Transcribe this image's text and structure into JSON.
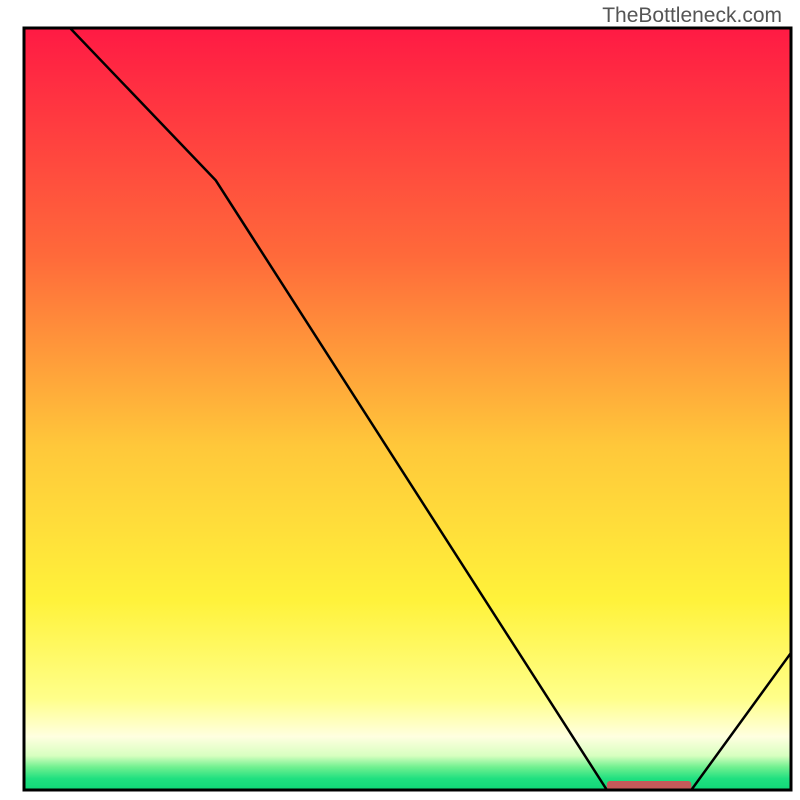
{
  "watermark": "TheBottleneck.com",
  "chart_data": {
    "type": "line",
    "title": "",
    "xlabel": "",
    "ylabel": "",
    "xlim": [
      0,
      100
    ],
    "ylim": [
      0,
      100
    ],
    "x": [
      6,
      25,
      76,
      87,
      100
    ],
    "values": [
      100,
      80,
      0,
      0,
      18
    ],
    "marker_region": {
      "x_start": 76,
      "x_end": 87,
      "y": 0,
      "color": "#c45a5a"
    },
    "gradient_stops": [
      {
        "offset": 0,
        "color": "#ff1a44"
      },
      {
        "offset": 30,
        "color": "#ff6a3a"
      },
      {
        "offset": 55,
        "color": "#ffc83a"
      },
      {
        "offset": 75,
        "color": "#fff23a"
      },
      {
        "offset": 88,
        "color": "#ffff8a"
      },
      {
        "offset": 93,
        "color": "#ffffe0"
      },
      {
        "offset": 95.5,
        "color": "#d8ffc0"
      },
      {
        "offset": 97,
        "color": "#70f090"
      },
      {
        "offset": 98.5,
        "color": "#20e080"
      },
      {
        "offset": 100,
        "color": "#10d878"
      }
    ]
  }
}
